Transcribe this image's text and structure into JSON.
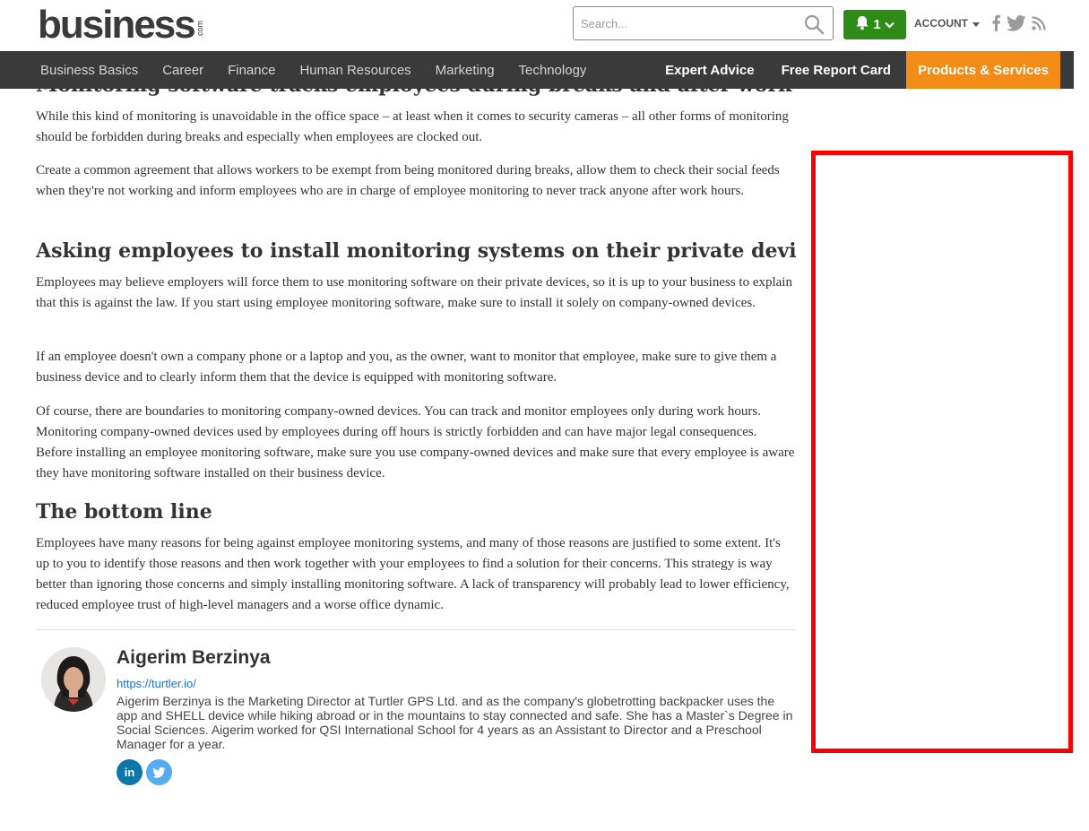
{
  "header": {
    "logo_text": "business",
    "logo_suffix": ".com",
    "search_placeholder": "Search...",
    "notification_count": "1",
    "account_label": "ACCOUNT"
  },
  "nav": {
    "items": [
      "Business Basics",
      "Career",
      "Finance",
      "Human Resources",
      "Marketing",
      "Technology"
    ],
    "expert_advice": "Expert Advice",
    "free_report_card": "Free Report Card",
    "products_services": "Products & Services"
  },
  "colors": {
    "nav_bg": "#3a3a3a",
    "accent_orange": "#f38b17",
    "notif_green": "#2e8b17",
    "ad_outline": "#ff0000",
    "link_blue": "#1a73c7"
  },
  "article": {
    "cut_heading": "Monitoring software tracks employees during breaks and after work",
    "p1": "While this kind of monitoring is unavoidable in the office space – at least when it comes to security cameras – all other forms of monitoring should be forbidden during breaks and especially when employees are clocked out.",
    "p2": "Create a common agreement that allows workers to be exempt from being monitored during breaks, allow them to check their social feeds when they're not working and inform employees who are in charge of employee monitoring to never track anyone after work hours.",
    "h2_private": "Asking employees to install monitoring systems on their private devices",
    "p3": "Employees may believe employers will force them to use monitoring software on their private devices, so it is up to your business to explain that this is against the law. If you start using employee monitoring software, make sure to install it solely on company-owned devices.",
    "p4": "If an employee doesn't own a company phone or a laptop and you, as the owner, want to monitor that employee, make sure to give them a business device and to clearly inform them that the device is equipped with monitoring software.",
    "p5": "Of course, there are boundaries to monitoring company-owned devices. You can track and monitor employees only during work hours. Monitoring company-owned devices used by employees during off hours is strictly forbidden and can have major legal consequences. Before installing an employee monitoring software, make sure you use company-owned devices and make sure that every employee is aware they have monitoring software installed on their business device.",
    "h2_bottom": "The bottom line",
    "p6": "Employees have many reasons for being against employee monitoring systems, and many of those reasons are justified to some extent. It's up to you to identify those reasons and then work together with your employees to find a solution for their concerns. This strategy is way better than ignoring those concerns and simply installing monitoring software. A lack of transparency will probably lead to lower efficiency, reduced employee trust of high-level managers and a worse office dynamic."
  },
  "author": {
    "name": "Aigerim Berzinya",
    "url": "https://turtler.io/",
    "bio": "Aigerim Berzinya is the Marketing Director at Turtler GPS Ltd. and as the company's globetrotting backpacker uses the app and SHELL device while hiking abroad or in the mountains to stay connected and safe. She has a Master`s Degree in Social Sciences. Aigerim worked for QSI International School for 4 years as an Assistant to Director and a Preschool Manager for a year.",
    "linkedin_label": "in"
  },
  "icons": {
    "search": "search-icon",
    "bell": "bell-icon",
    "chevron": "chevron-down-icon",
    "facebook": "facebook-icon",
    "twitter": "twitter-icon",
    "rss": "rss-icon",
    "linkedin": "linkedin-icon"
  }
}
